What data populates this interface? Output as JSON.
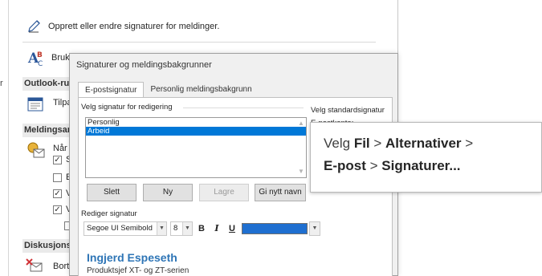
{
  "background_window": {
    "top_row_label": "Opprett eller endre signaturer for meldinger.",
    "bruk_label": "Bruk",
    "left_edge_letter": "r",
    "sections": [
      {
        "title": "Outlook-rut"
      },
      {
        "title": "Meldingsan"
      },
      {
        "title": "Diskusjonsc"
      }
    ],
    "tilpa_label": "Tilpa",
    "naar_label": "Når",
    "checkbox_letters": [
      "S",
      "E",
      "V",
      "V"
    ],
    "checkbox_states": [
      true,
      false,
      true,
      true
    ],
    "bort_label": "Bort"
  },
  "dialog": {
    "title": "Signaturer og meldingsbakgrunner",
    "tabs": [
      {
        "label": "E-postsignatur",
        "active": true
      },
      {
        "label": "Personlig meldingsbakgrunn",
        "active": false
      }
    ],
    "select_signature_label": "Velg signatur for redigering",
    "signatures": [
      {
        "label": "Personlig",
        "selected": false
      },
      {
        "label": "Arbeid",
        "selected": true
      }
    ],
    "default_signature_label": "Velg standardsignatur",
    "email_account_label": "E-postkonto:",
    "buttons": {
      "delete": "Slett",
      "new": "Ny",
      "save": "Lagre",
      "rename": "Gi nytt navn"
    },
    "edit_signature_label": "Rediger signatur",
    "font_name": "Segoe UI Semibold",
    "font_size": "8",
    "bold": "B",
    "italic": "I",
    "underline": "U",
    "font_color": "#1f6fd0",
    "signature_name": "Ingjerd Espeseth",
    "signature_title": "Produktsjef XT- og ZT-serien"
  },
  "callout": {
    "line1": {
      "p1": "Velg ",
      "b1": "Fil",
      "p2": " > ",
      "b2": "Alternativer",
      "p3": " >"
    },
    "line2": {
      "b1": "E-post",
      "p1": " > ",
      "b2": "Signaturer..."
    }
  }
}
